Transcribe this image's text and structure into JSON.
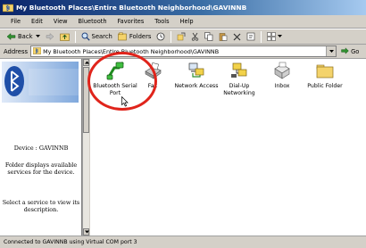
{
  "window": {
    "title": "My Bluetooth Places\\Entire Bluetooth Neighborhood\\GAVINNB"
  },
  "menu": [
    "File",
    "Edit",
    "View",
    "Bluetooth",
    "Favorites",
    "Tools",
    "Help"
  ],
  "toolbar": {
    "back_label": "Back",
    "search_label": "Search",
    "folders_label": "Folders"
  },
  "address": {
    "label": "Address",
    "value": "My Bluetooth Places\\Entire Bluetooth Neighborhood\\GAVINNB",
    "go_label": "Go"
  },
  "left_pane": {
    "device_line": "Device : GAVINNB",
    "info_line": "Folder displays available services for the device.",
    "hint_line": "Select a service to view its description."
  },
  "services": [
    {
      "label": "Bluetooth Serial Port",
      "icon": "serial-port-icon"
    },
    {
      "label": "Fax",
      "icon": "fax-icon"
    },
    {
      "label": "Network Access",
      "icon": "network-access-icon"
    },
    {
      "label": "Dial-Up Networking",
      "icon": "dialup-networking-icon"
    },
    {
      "label": "Inbox",
      "icon": "inbox-icon"
    },
    {
      "label": "Public Folder",
      "icon": "folder-icon"
    }
  ],
  "status": {
    "text": "Connected to GAVINNB using Virtual COM port 3"
  },
  "colors": {
    "highlight_circle": "#e0241b",
    "title_bar": "#0a246a"
  }
}
